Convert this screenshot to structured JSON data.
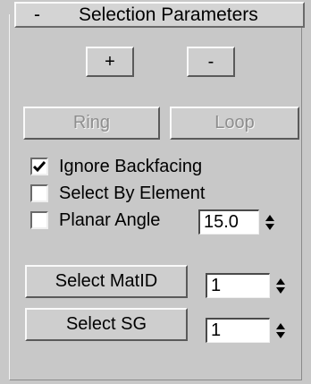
{
  "rollout": {
    "toggle": "-",
    "title": "Selection Parameters"
  },
  "grow_button": "+",
  "shrink_button": "-",
  "ring_button": "Ring",
  "loop_button": "Loop",
  "options": [
    {
      "label": "Ignore Backfacing",
      "checked": true
    },
    {
      "label": "Select By Element",
      "checked": false
    },
    {
      "label": "Planar Angle",
      "checked": false
    }
  ],
  "planar_angle_value": "15.0",
  "select_matid_button": "Select MatID",
  "matid_value": "1",
  "select_sg_button": "Select SG",
  "sg_value": "1"
}
